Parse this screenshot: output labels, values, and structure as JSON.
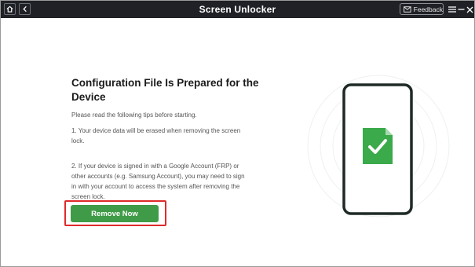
{
  "window": {
    "title": "Screen Unlocker",
    "feedback_label": "Feedback",
    "icons": [
      "home-icon",
      "back-arrow-icon",
      "mail-icon",
      "menu-icon",
      "minimize-icon",
      "close-icon"
    ]
  },
  "main": {
    "heading": "Configuration File Is Prepared for the Device",
    "intro": "Please read the following tips before starting.",
    "tips": [
      "1. Your device data will be erased when removing the screen lock.",
      "2. If your device is signed in with a Google Account (FRP) or other accounts (e.g. Samsung Account), you may need to sign in with your account to access the system after removing the screen lock."
    ],
    "remove_button_label": "Remove Now"
  },
  "colors": {
    "titlebar": "#1f2126",
    "button": "#3f9b47",
    "highlight": "#e02a2a",
    "phone_outline": "#1e2a26",
    "file_icon": "#3aaa4a"
  },
  "illustration": {
    "icons": [
      "smartphone-icon",
      "file-check-icon"
    ]
  }
}
